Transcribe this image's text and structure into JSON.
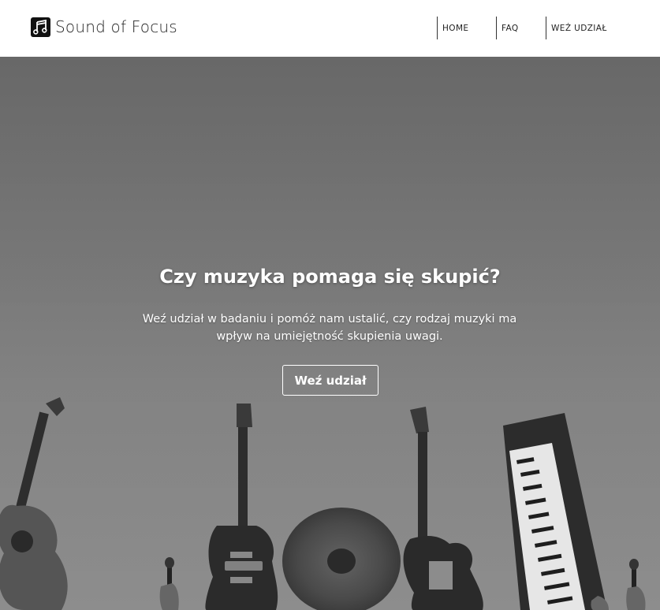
{
  "navbar": {
    "brand": {
      "icon": "music-note-icon",
      "title": "Sound of Focus"
    },
    "links": [
      {
        "label": "HOME"
      },
      {
        "label": "FAQ"
      },
      {
        "label": "WEŹ UDZIAŁ"
      }
    ]
  },
  "hero": {
    "background_image": "grayscale-instruments-raised-hands-photo",
    "title": "Czy muzyka pomaga się skupić?",
    "subtitle": "Weź udział w badaniu i pomóż nam ustalić, czy rodzaj muzyki ma wpływ na umiejętność skupienia uwagi.",
    "cta_label": "Weź udział"
  },
  "colors": {
    "navbar_bg": "#ffffff",
    "nav_text": "#222222",
    "hero_text": "#ffffff"
  }
}
